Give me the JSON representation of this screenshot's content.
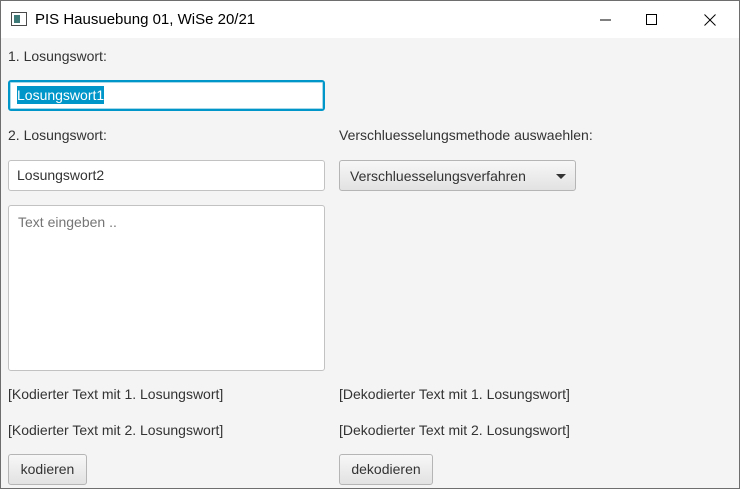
{
  "window": {
    "title": "PIS Hausuebung 01, WiSe 20/21",
    "controls": [
      "minimize-icon",
      "maximize-icon",
      "close-icon"
    ]
  },
  "form": {
    "label_word1": "1. Losungswort:",
    "word1_value": "Losungswort1",
    "label_word2": "2. Losungswort:",
    "word2_value": "Losungswort2",
    "textarea_placeholder": "Text eingeben ..",
    "method_label": "Verschluesselungsmethode auswaehlen:",
    "method_selected": "Verschluesselungsverfahren",
    "encoded_1": "[Kodierter Text mit 1. Losungswort]",
    "decoded_1": "[Dekodierter Text mit 1. Losungswort]",
    "encoded_2": "[Kodierter Text mit 2. Losungswort]",
    "decoded_2": "[Dekodierter Text mit 2. Losungswort]",
    "encode_button": "kodieren",
    "decode_button": "dekodieren"
  },
  "colors": {
    "focus_accent": "#0096c9",
    "window_background": "#f4f4f4",
    "titlebar_background": "#ffffff"
  }
}
